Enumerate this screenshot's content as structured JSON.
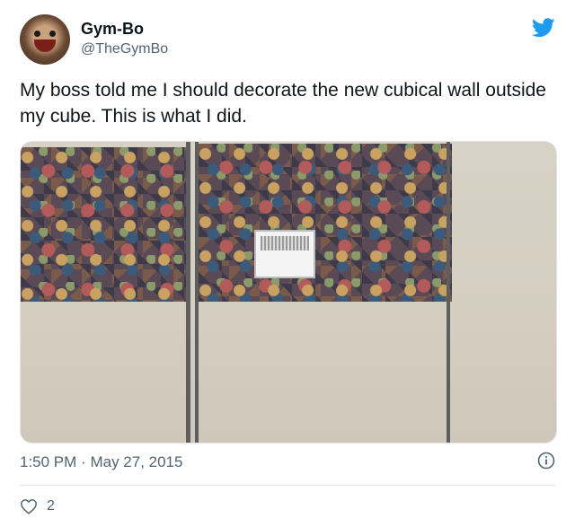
{
  "author": {
    "name": "Gym-Bo",
    "handle": "@TheGymBo"
  },
  "tweet": {
    "text": "My boss told me I should decorate the new cubical wall outside my cube. This is what I did."
  },
  "meta": {
    "time": "1:50 PM",
    "separator": "·",
    "date": "May 27, 2015",
    "like_count": "2"
  },
  "icons": {
    "brand": "twitter-bird-icon",
    "info": "info-icon",
    "like": "heart-icon"
  },
  "colors": {
    "brand": "#1d9bf0",
    "muted": "#536471",
    "text": "#0f1419"
  }
}
